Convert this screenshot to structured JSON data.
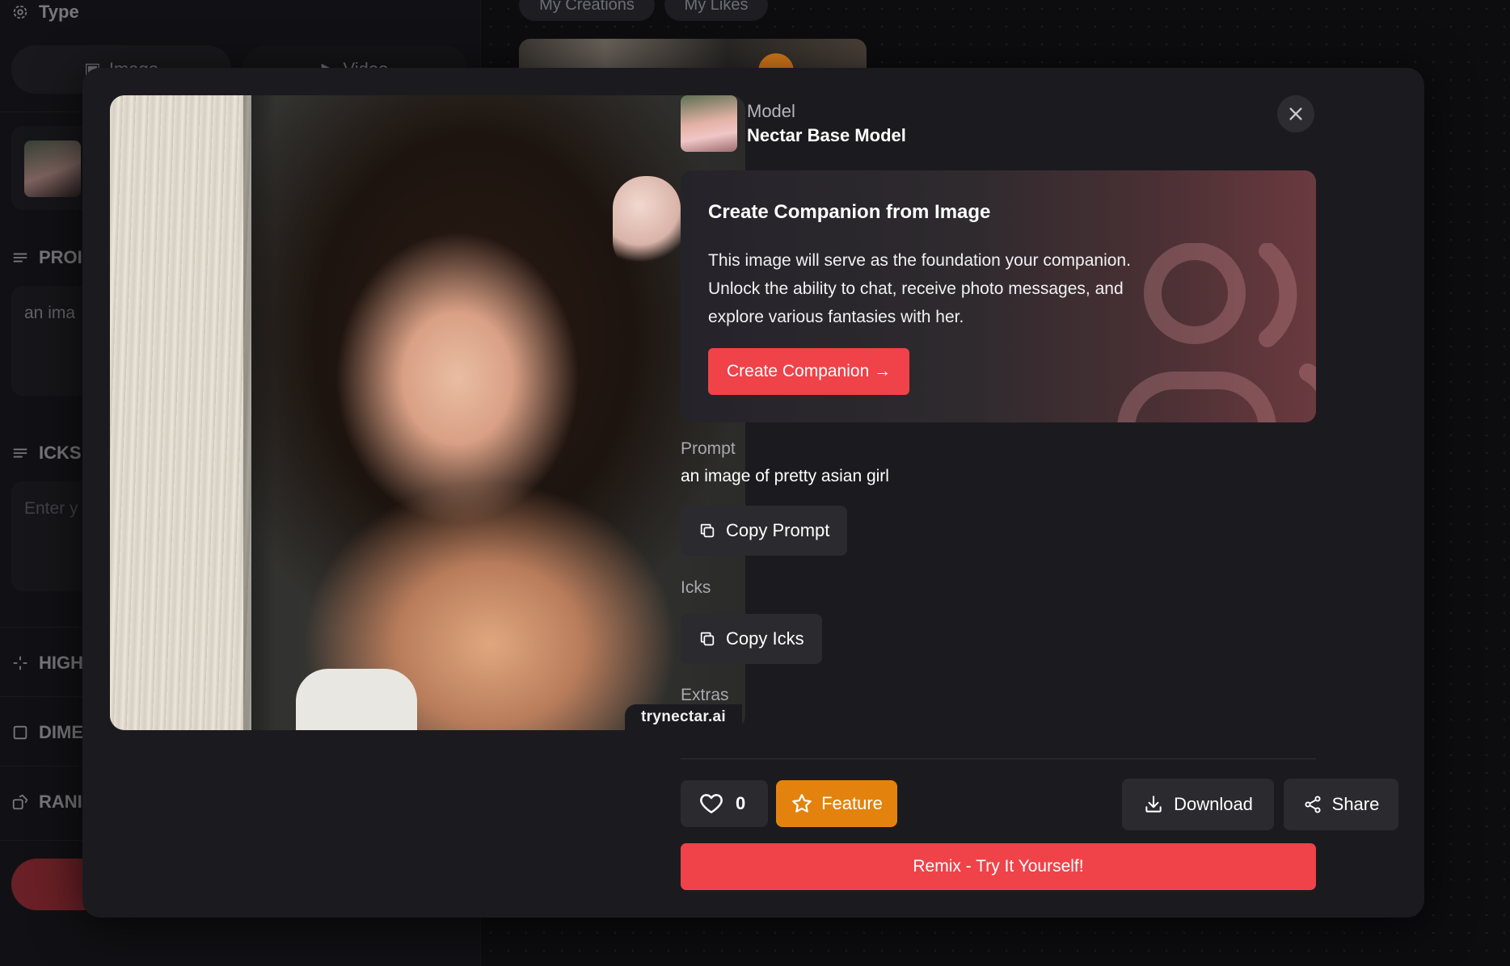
{
  "sidebar": {
    "type_title": "Type",
    "type_options": [
      "Image",
      "Video"
    ],
    "prompt_title": "PROI",
    "prompt_value": "an ima",
    "icks_title": "ICKS",
    "icks_placeholder": "Enter y",
    "highres_title": "HIGH",
    "dimensions_title": "DIME",
    "random_title": "RANI"
  },
  "top_tabs": [
    "My Creations",
    "My Likes"
  ],
  "modal": {
    "watermark": "trynectar.ai",
    "model": {
      "label": "Model",
      "name": "Nectar Base Model"
    },
    "companion": {
      "title": "Create Companion from Image",
      "body": "This image will serve as the foundation your companion. Unlock the ability to chat, receive photo messages, and explore various fantasies with her.",
      "button": "Create Companion →"
    },
    "prompt": {
      "label": "Prompt",
      "text": "an image of pretty asian girl",
      "copy_button": "Copy Prompt"
    },
    "icks": {
      "label": "Icks",
      "copy_button": "Copy Icks"
    },
    "extras": {
      "label": "Extras"
    },
    "actions": {
      "like_count": "0",
      "feature": "Feature",
      "download": "Download",
      "share": "Share",
      "remix": "Remix - Try It Yourself!"
    }
  },
  "colors": {
    "accent_red": "#f04249",
    "feature_orange": "#e3830d",
    "modal_bg": "#1b1b1f",
    "button_bg": "#2a2a2f"
  }
}
